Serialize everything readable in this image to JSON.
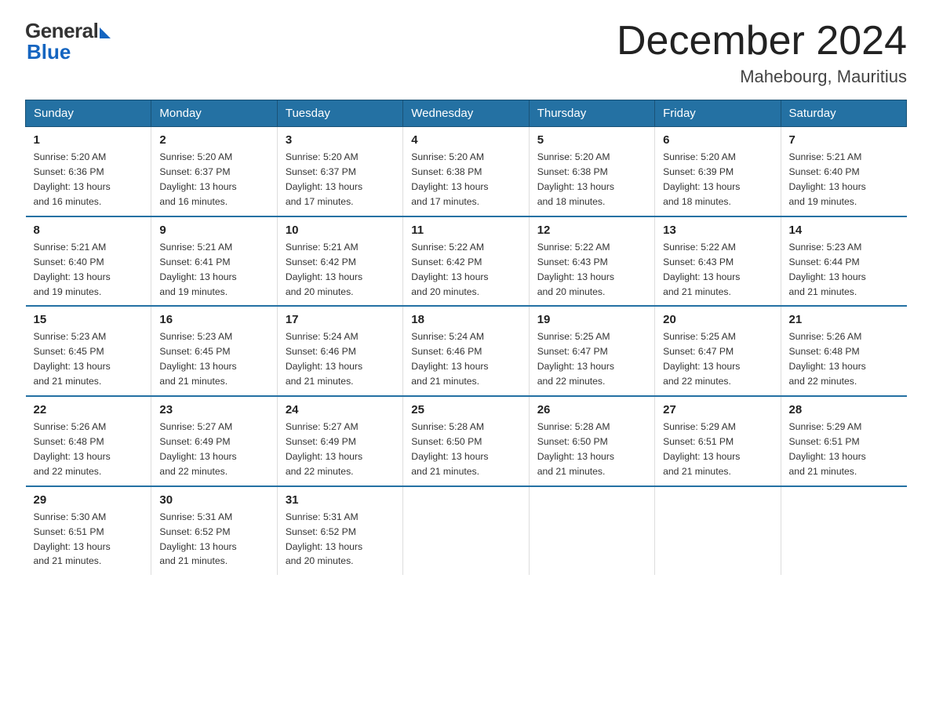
{
  "logo": {
    "general": "General",
    "blue": "Blue"
  },
  "title": {
    "month_year": "December 2024",
    "location": "Mahebourg, Mauritius"
  },
  "days_of_week": [
    "Sunday",
    "Monday",
    "Tuesday",
    "Wednesday",
    "Thursday",
    "Friday",
    "Saturday"
  ],
  "weeks": [
    [
      {
        "num": "1",
        "sunrise": "5:20 AM",
        "sunset": "6:36 PM",
        "daylight": "13 hours and 16 minutes."
      },
      {
        "num": "2",
        "sunrise": "5:20 AM",
        "sunset": "6:37 PM",
        "daylight": "13 hours and 16 minutes."
      },
      {
        "num": "3",
        "sunrise": "5:20 AM",
        "sunset": "6:37 PM",
        "daylight": "13 hours and 17 minutes."
      },
      {
        "num": "4",
        "sunrise": "5:20 AM",
        "sunset": "6:38 PM",
        "daylight": "13 hours and 17 minutes."
      },
      {
        "num": "5",
        "sunrise": "5:20 AM",
        "sunset": "6:38 PM",
        "daylight": "13 hours and 18 minutes."
      },
      {
        "num": "6",
        "sunrise": "5:20 AM",
        "sunset": "6:39 PM",
        "daylight": "13 hours and 18 minutes."
      },
      {
        "num": "7",
        "sunrise": "5:21 AM",
        "sunset": "6:40 PM",
        "daylight": "13 hours and 19 minutes."
      }
    ],
    [
      {
        "num": "8",
        "sunrise": "5:21 AM",
        "sunset": "6:40 PM",
        "daylight": "13 hours and 19 minutes."
      },
      {
        "num": "9",
        "sunrise": "5:21 AM",
        "sunset": "6:41 PM",
        "daylight": "13 hours and 19 minutes."
      },
      {
        "num": "10",
        "sunrise": "5:21 AM",
        "sunset": "6:42 PM",
        "daylight": "13 hours and 20 minutes."
      },
      {
        "num": "11",
        "sunrise": "5:22 AM",
        "sunset": "6:42 PM",
        "daylight": "13 hours and 20 minutes."
      },
      {
        "num": "12",
        "sunrise": "5:22 AM",
        "sunset": "6:43 PM",
        "daylight": "13 hours and 20 minutes."
      },
      {
        "num": "13",
        "sunrise": "5:22 AM",
        "sunset": "6:43 PM",
        "daylight": "13 hours and 21 minutes."
      },
      {
        "num": "14",
        "sunrise": "5:23 AM",
        "sunset": "6:44 PM",
        "daylight": "13 hours and 21 minutes."
      }
    ],
    [
      {
        "num": "15",
        "sunrise": "5:23 AM",
        "sunset": "6:45 PM",
        "daylight": "13 hours and 21 minutes."
      },
      {
        "num": "16",
        "sunrise": "5:23 AM",
        "sunset": "6:45 PM",
        "daylight": "13 hours and 21 minutes."
      },
      {
        "num": "17",
        "sunrise": "5:24 AM",
        "sunset": "6:46 PM",
        "daylight": "13 hours and 21 minutes."
      },
      {
        "num": "18",
        "sunrise": "5:24 AM",
        "sunset": "6:46 PM",
        "daylight": "13 hours and 21 minutes."
      },
      {
        "num": "19",
        "sunrise": "5:25 AM",
        "sunset": "6:47 PM",
        "daylight": "13 hours and 22 minutes."
      },
      {
        "num": "20",
        "sunrise": "5:25 AM",
        "sunset": "6:47 PM",
        "daylight": "13 hours and 22 minutes."
      },
      {
        "num": "21",
        "sunrise": "5:26 AM",
        "sunset": "6:48 PM",
        "daylight": "13 hours and 22 minutes."
      }
    ],
    [
      {
        "num": "22",
        "sunrise": "5:26 AM",
        "sunset": "6:48 PM",
        "daylight": "13 hours and 22 minutes."
      },
      {
        "num": "23",
        "sunrise": "5:27 AM",
        "sunset": "6:49 PM",
        "daylight": "13 hours and 22 minutes."
      },
      {
        "num": "24",
        "sunrise": "5:27 AM",
        "sunset": "6:49 PM",
        "daylight": "13 hours and 22 minutes."
      },
      {
        "num": "25",
        "sunrise": "5:28 AM",
        "sunset": "6:50 PM",
        "daylight": "13 hours and 21 minutes."
      },
      {
        "num": "26",
        "sunrise": "5:28 AM",
        "sunset": "6:50 PM",
        "daylight": "13 hours and 21 minutes."
      },
      {
        "num": "27",
        "sunrise": "5:29 AM",
        "sunset": "6:51 PM",
        "daylight": "13 hours and 21 minutes."
      },
      {
        "num": "28",
        "sunrise": "5:29 AM",
        "sunset": "6:51 PM",
        "daylight": "13 hours and 21 minutes."
      }
    ],
    [
      {
        "num": "29",
        "sunrise": "5:30 AM",
        "sunset": "6:51 PM",
        "daylight": "13 hours and 21 minutes."
      },
      {
        "num": "30",
        "sunrise": "5:31 AM",
        "sunset": "6:52 PM",
        "daylight": "13 hours and 21 minutes."
      },
      {
        "num": "31",
        "sunrise": "5:31 AM",
        "sunset": "6:52 PM",
        "daylight": "13 hours and 20 minutes."
      },
      null,
      null,
      null,
      null
    ]
  ],
  "labels": {
    "sunrise": "Sunrise:",
    "sunset": "Sunset:",
    "daylight": "Daylight:"
  }
}
